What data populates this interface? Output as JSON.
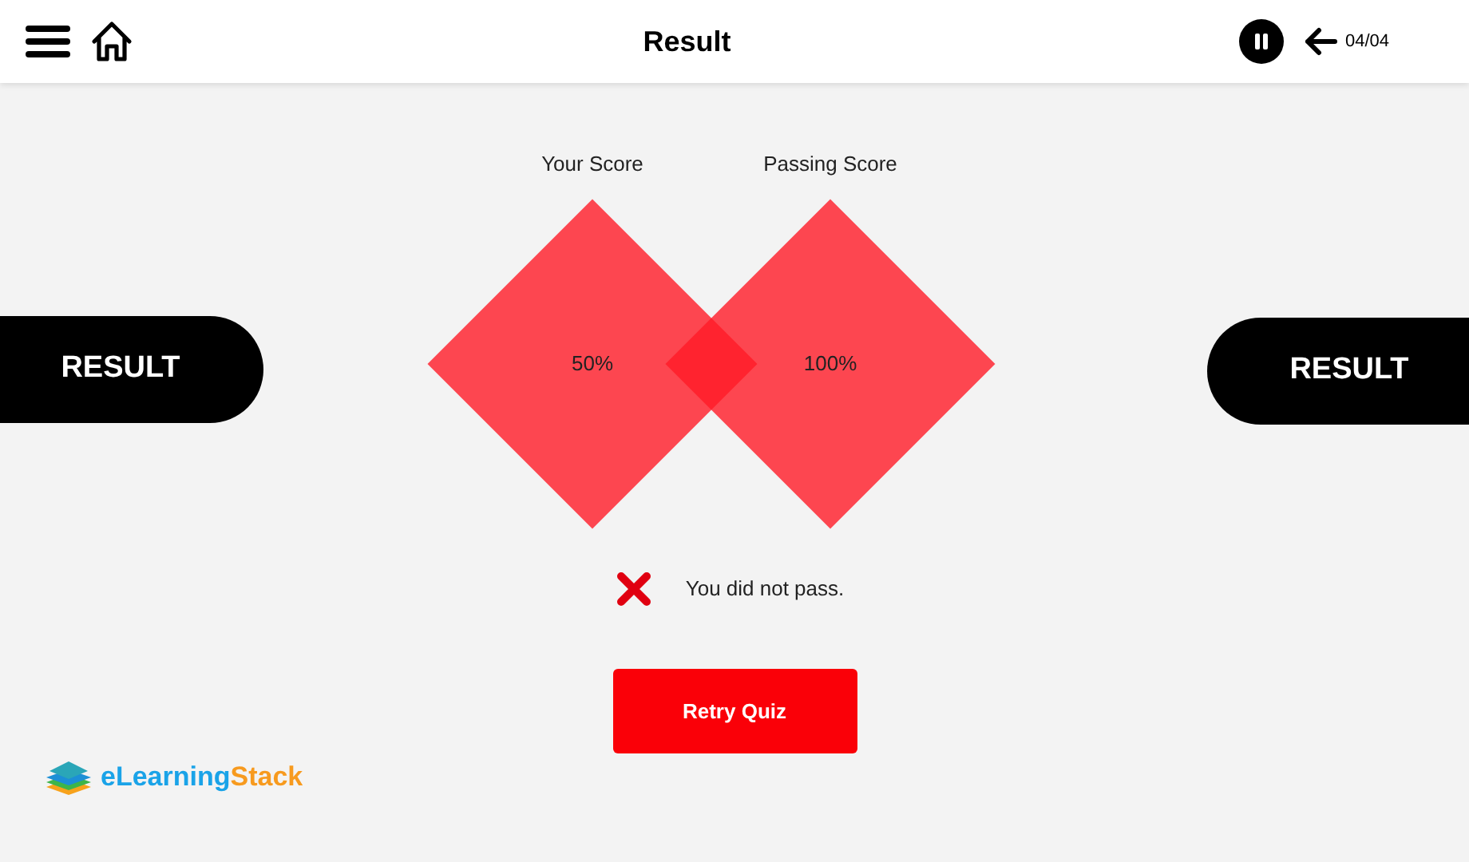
{
  "header": {
    "title": "Result",
    "counter": "04/04"
  },
  "side_labels": [
    "RESULT",
    "RESULT"
  ],
  "scores": [
    {
      "label": "Your Score",
      "value": "50%"
    },
    {
      "label": "Passing Score",
      "value": "100%"
    }
  ],
  "feedback": {
    "passed": false,
    "text": "You did not pass."
  },
  "retry_button": "Retry Quiz",
  "logo": {
    "part_1": "eLearning",
    "part_2": "Stack"
  }
}
